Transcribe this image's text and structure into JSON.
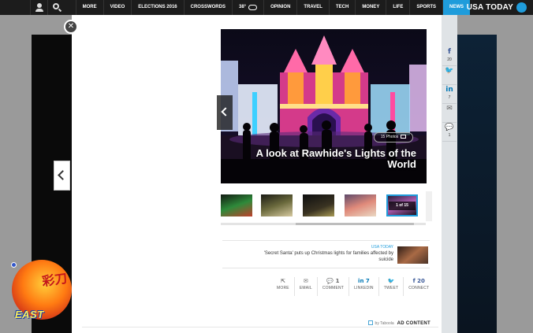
{
  "header": {
    "brand": "USA TODAY",
    "nav": [
      "NEWS",
      "SPORTS",
      "LIFE",
      "MONEY",
      "TECH",
      "TRAVEL",
      "OPINION",
      "38°",
      "CROSSWORDS",
      "ELECTIONS 2016",
      "VIDEO",
      "MORE"
    ],
    "active_index": 0
  },
  "gallery": {
    "title": "A look at Rawhide's Lights of the World",
    "photo_count": "15 Photos",
    "position": "1 of 15",
    "thumbnails": [
      "thumb-1",
      "thumb-2",
      "thumb-3",
      "thumb-4",
      "thumb-5"
    ],
    "selected_thumb": 1
  },
  "share_rail": [
    {
      "icon": "facebook-icon",
      "glyph": "f",
      "count": "20"
    },
    {
      "icon": "twitter-icon",
      "glyph": "🐦",
      "count": ""
    },
    {
      "icon": "linkedin-icon",
      "glyph": "in",
      "count": "7"
    },
    {
      "icon": "email-icon",
      "glyph": "✉",
      "count": ""
    },
    {
      "icon": "comment-icon",
      "glyph": "💬",
      "count": "1"
    }
  ],
  "related": {
    "source": "USA TODAY",
    "headline": "'Secret Santa' puts up Christmas lights for families affected by suicide"
  },
  "sharebar": [
    {
      "key": "connect",
      "glyph": "f 20",
      "label": "CONNECT"
    },
    {
      "key": "tweet",
      "glyph": "🐦",
      "label": "TWEET"
    },
    {
      "key": "linkedin",
      "glyph": "in 7",
      "label": "LINKEDIN"
    },
    {
      "key": "comment",
      "glyph": "💬 1",
      "label": "COMMENT"
    },
    {
      "key": "email",
      "glyph": "✉",
      "label": "EMAIL"
    },
    {
      "key": "more",
      "glyph": "⇱",
      "label": "MORE"
    }
  ],
  "ad": {
    "label": "AD CONTENT",
    "by": "by Taboola"
  },
  "sticker": {
    "marks": "彩刀",
    "word": "EAST"
  },
  "colors": {
    "accent": "#1f9cdb",
    "topbar": "#1c1c1c"
  }
}
